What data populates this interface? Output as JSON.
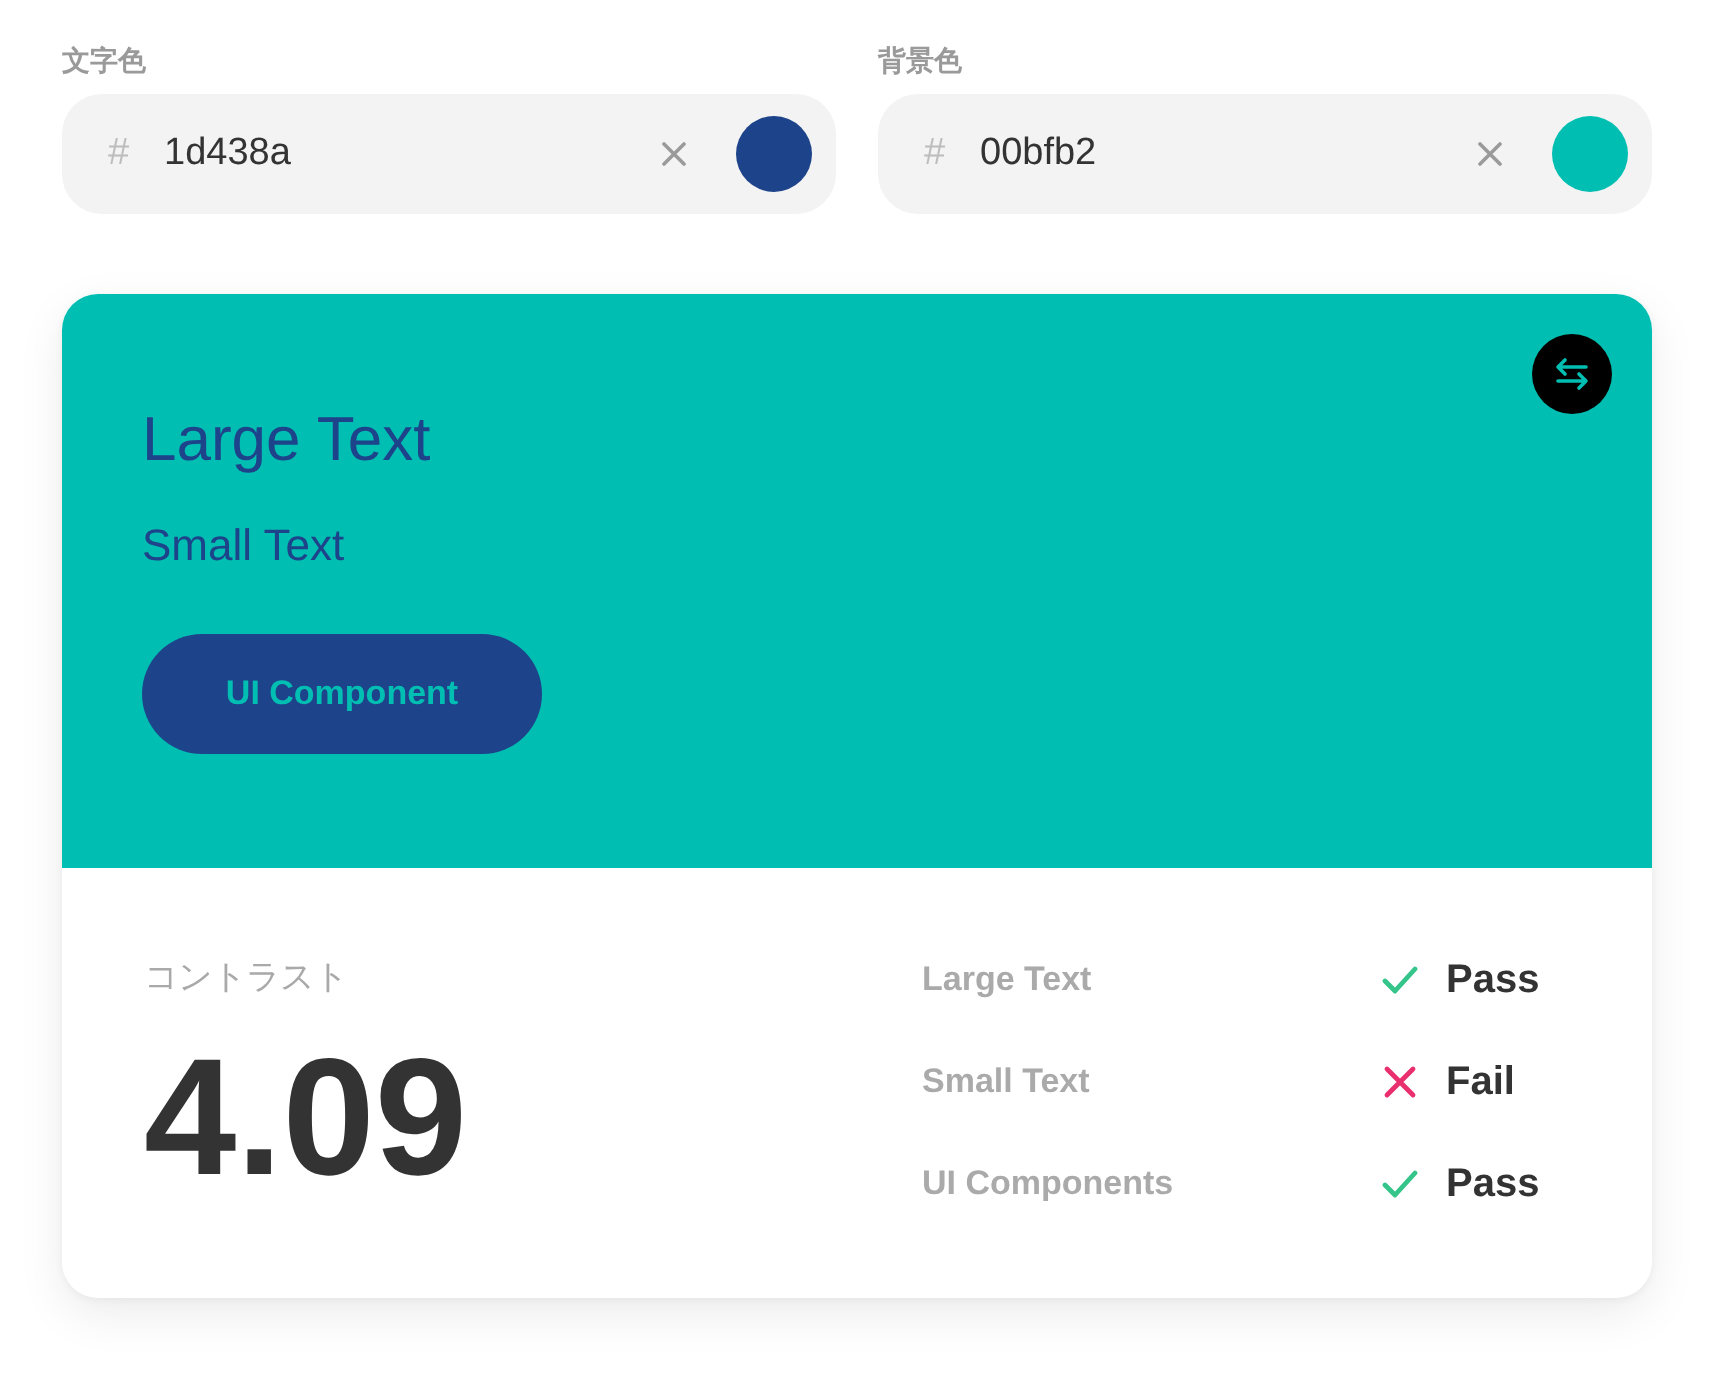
{
  "fields": [
    {
      "label": "文字色",
      "prefix": "#",
      "value": "1d438a",
      "color": "#1d438a"
    },
    {
      "label": "背景色",
      "prefix": "#",
      "value": "00bfb2",
      "color": "#00bfb2"
    }
  ],
  "preview": {
    "large_text": "Large Text",
    "small_text": "Small Text",
    "button": "UI Component"
  },
  "result": {
    "label": "コントラスト",
    "ratio": "4.09",
    "checks": [
      {
        "name": "Large Text",
        "passed": true,
        "verdict": "Pass"
      },
      {
        "name": "Small Text",
        "passed": false,
        "verdict": "Fail"
      },
      {
        "name": "UI Components",
        "passed": true,
        "verdict": "Pass"
      }
    ]
  }
}
